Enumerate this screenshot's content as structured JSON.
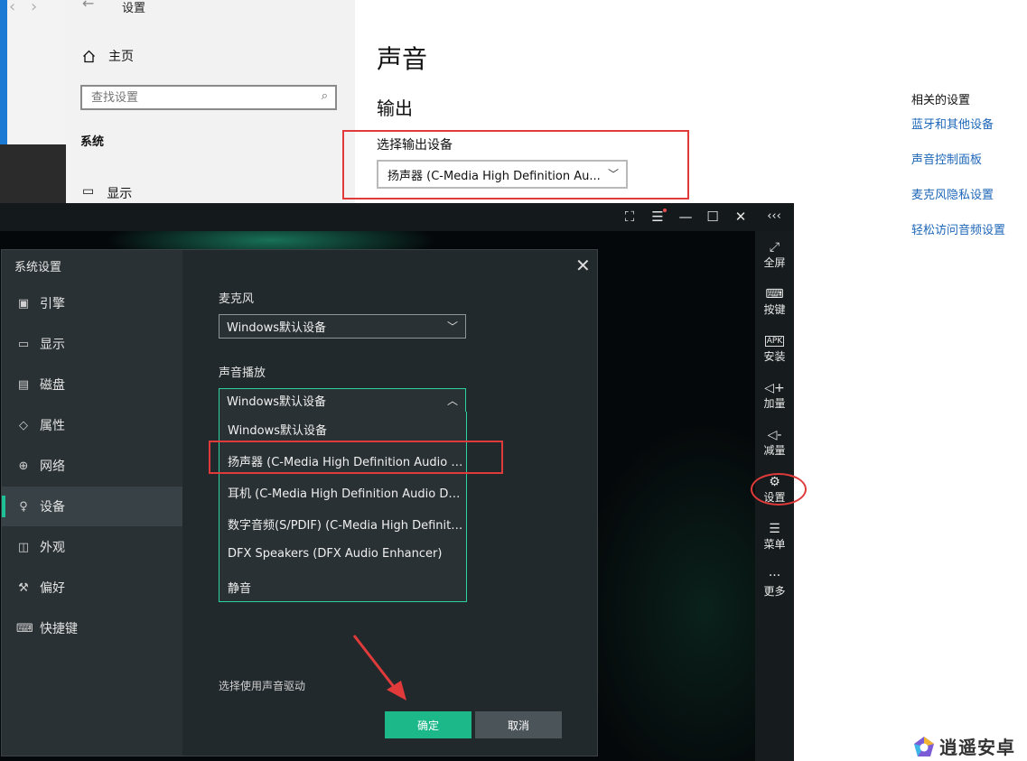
{
  "windows_settings": {
    "title": "设置",
    "home_label": "主页",
    "search_placeholder": "查找设置",
    "section_label": "系统",
    "display_label": "显示",
    "heading": "声音",
    "output_heading": "输出",
    "choose_output_label": "选择输出设备",
    "output_device_value": "扬声器 (C-Media High Definition Au...",
    "related_title": "相关的设置",
    "related_links": [
      "蓝牙和其他设备",
      "声音控制面板",
      "麦克风隐私设置",
      "轻松访问音频设置"
    ]
  },
  "emulator": {
    "collapse_label": "‹‹‹",
    "toolbar": [
      {
        "icon": "fullscreen-icon",
        "label": "全屏"
      },
      {
        "icon": "keyboard-icon",
        "label": "按键"
      },
      {
        "icon": "apk-icon",
        "label": "安装"
      },
      {
        "icon": "volume-up-icon",
        "label": "加量"
      },
      {
        "icon": "volume-down-icon",
        "label": "减量"
      },
      {
        "icon": "gear-icon",
        "label": "设置"
      },
      {
        "icon": "menu-icon",
        "label": "菜单"
      },
      {
        "icon": "more-icon",
        "label": "更多"
      }
    ]
  },
  "dialog": {
    "title": "系统设置",
    "nav": [
      {
        "icon": "chip-icon",
        "label": "引擎"
      },
      {
        "icon": "monitor-icon",
        "label": "显示"
      },
      {
        "icon": "disk-icon",
        "label": "磁盘"
      },
      {
        "icon": "tag-icon",
        "label": "属性"
      },
      {
        "icon": "globe-icon",
        "label": "网络"
      },
      {
        "icon": "microphone-icon",
        "label": "设备",
        "active": true
      },
      {
        "icon": "appearance-icon",
        "label": "外观"
      },
      {
        "icon": "wrench-icon",
        "label": "偏好"
      },
      {
        "icon": "keyboard-icon",
        "label": "快捷键"
      }
    ],
    "mic_label": "麦克风",
    "mic_value": "Windows默认设备",
    "playback_label": "声音播放",
    "playback_value": "Windows默认设备",
    "playback_options": [
      "Windows默认设备",
      "扬声器 (C-Media High Definition Audio Dev...",
      "耳机 (C-Media High Definition Audio Device)",
      "数字音频(S/PDIF) (C-Media High Definition ...",
      "DFX Speakers (DFX Audio Enhancer)",
      "静音"
    ],
    "driver_label": "选择使用声音驱动",
    "ok_label": "确定",
    "cancel_label": "取消"
  },
  "watermark": "逍遥安卓",
  "colors": {
    "accent": "#1db889",
    "highlight_red": "#e03a3a",
    "link_blue": "#1e67b8"
  }
}
